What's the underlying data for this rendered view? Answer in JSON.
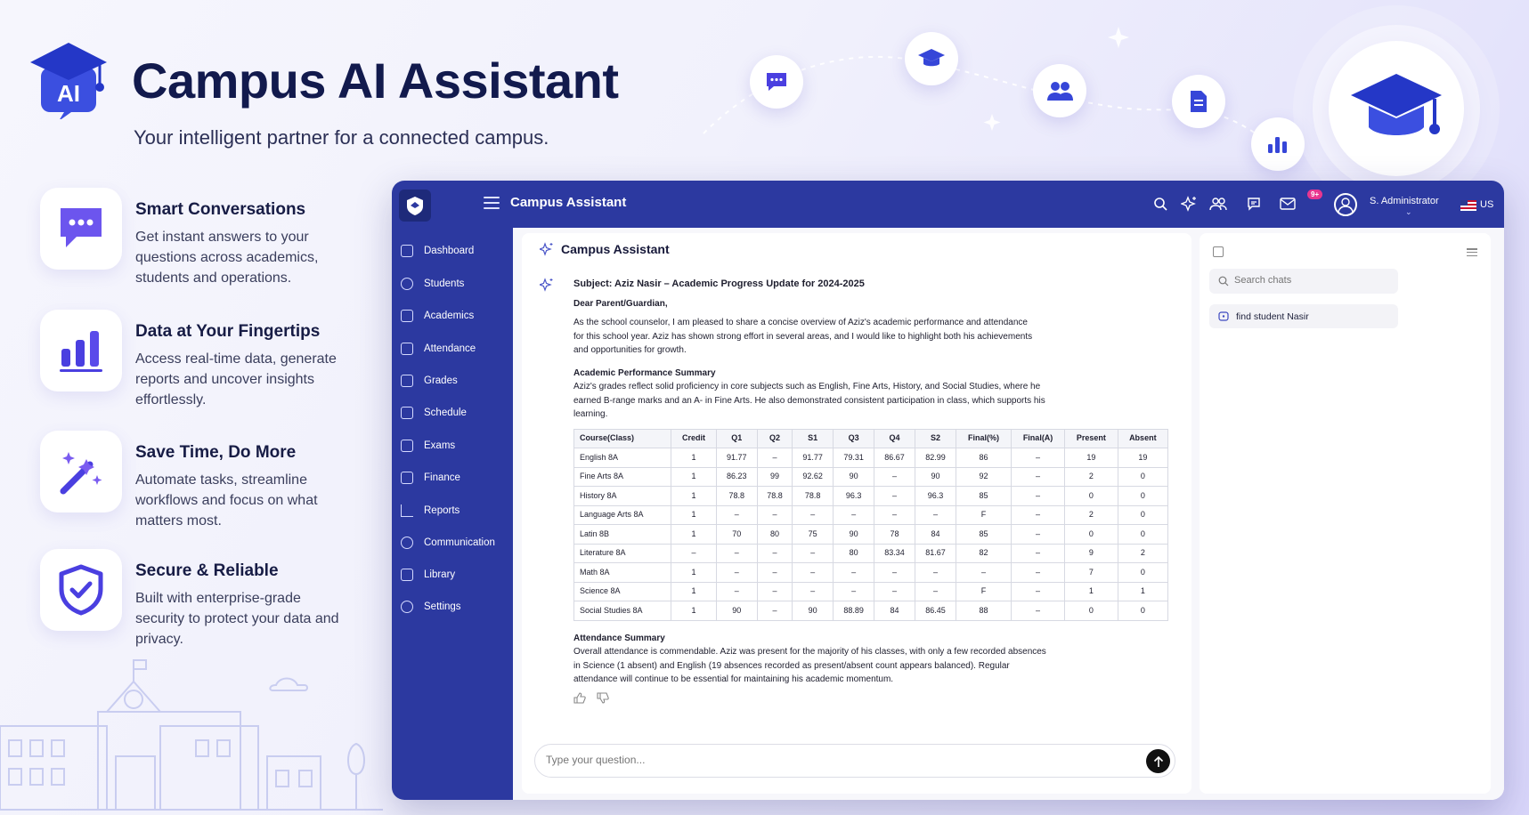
{
  "hero": {
    "logo_text": "AI",
    "title": "Campus AI Assistant",
    "subtitle": "Your intelligent partner for a connected campus."
  },
  "float_icons": [
    "chat-bubble-icon",
    "graduation-cap-icon",
    "users-icon",
    "document-icon",
    "bar-chart-icon",
    "graduation-cap-icon"
  ],
  "features": [
    {
      "icon": "chat-bubble-icon",
      "title": "Smart Conversations",
      "desc": "Get instant answers to your questions across academics, students and operations."
    },
    {
      "icon": "bar-chart-icon",
      "title": "Data at Your Fingertips",
      "desc": "Access real-time data, generate reports and uncover insights effortlessly."
    },
    {
      "icon": "magic-wand-icon",
      "title": "Save Time, Do More",
      "desc": "Automate tasks, streamline workflows and focus on what matters most."
    },
    {
      "icon": "shield-check-icon",
      "title": "Secure & Reliable",
      "desc": "Built with enterprise-grade security to protect your data and privacy."
    }
  ],
  "app": {
    "title": "Campus Assistant",
    "badge": "9+",
    "user": "S. Administrator",
    "lang": "US",
    "nav": [
      "Dashboard",
      "Students",
      "Academics",
      "Attendance",
      "Grades",
      "Schedule",
      "Exams",
      "Finance",
      "Reports",
      "Communication",
      "Library",
      "Settings"
    ],
    "chat": {
      "title": "Campus Assistant",
      "subject": "Subject: Aziz Nasir – Academic Progress Update for 2024-2025",
      "greeting": "Dear Parent/Guardian,",
      "intro": "As the school counselor, I am pleased to share a concise overview of Aziz's academic performance and attendance for this school year. Aziz has shown strong effort in several areas, and I would like to highlight both his achievements and opportunities for growth.",
      "perf_heading": "Academic Performance Summary",
      "perf_text": "Aziz's grades reflect solid proficiency in core subjects such as English, Fine Arts, History, and Social Studies, where he earned B-range marks and an A- in Fine Arts. He also demonstrated consistent participation in class, which supports his learning.",
      "table": {
        "headers": [
          "Course(Class)",
          "Credit",
          "Q1",
          "Q2",
          "S1",
          "Q3",
          "Q4",
          "S2",
          "Final(%)",
          "Final(A)",
          "Present",
          "Absent"
        ],
        "rows": [
          [
            "English 8A",
            "1",
            "91.77",
            "–",
            "91.77",
            "79.31",
            "86.67",
            "82.99",
            "86",
            "–",
            "19",
            "19"
          ],
          [
            "Fine Arts 8A",
            "1",
            "86.23",
            "99",
            "92.62",
            "90",
            "–",
            "90",
            "92",
            "–",
            "2",
            "0"
          ],
          [
            "History 8A",
            "1",
            "78.8",
            "78.8",
            "78.8",
            "96.3",
            "–",
            "96.3",
            "85",
            "–",
            "0",
            "0"
          ],
          [
            "Language Arts 8A",
            "1",
            "–",
            "–",
            "–",
            "–",
            "–",
            "–",
            "F",
            "–",
            "2",
            "0"
          ],
          [
            "Latin 8B",
            "1",
            "70",
            "80",
            "75",
            "90",
            "78",
            "84",
            "85",
            "–",
            "0",
            "0"
          ],
          [
            "Literature 8A",
            "–",
            "–",
            "–",
            "–",
            "80",
            "83.34",
            "81.67",
            "82",
            "–",
            "9",
            "2"
          ],
          [
            "Math 8A",
            "1",
            "–",
            "–",
            "–",
            "–",
            "–",
            "–",
            "–",
            "–",
            "7",
            "0"
          ],
          [
            "Science 8A",
            "1",
            "–",
            "–",
            "–",
            "–",
            "–",
            "–",
            "F",
            "–",
            "1",
            "1"
          ],
          [
            "Social Studies 8A",
            "1",
            "90",
            "–",
            "90",
            "88.89",
            "84",
            "86.45",
            "88",
            "–",
            "0",
            "0"
          ]
        ]
      },
      "att_heading": "Attendance Summary",
      "att_text": "Overall attendance is commendable. Aziz was present for the majority of his classes, with only a few recorded absences in Science (1 absent) and English (19 absences recorded as present/absent count appears balanced). Regular attendance will continue to be essential for maintaining his academic momentum.",
      "input_placeholder": "Type your question..."
    },
    "history": {
      "search_placeholder": "Search chats",
      "items": [
        "find student Nasir"
      ]
    }
  },
  "colors": {
    "primary": "#2c39a0",
    "accent": "#5a4bea",
    "hero_title": "#121a4d"
  }
}
